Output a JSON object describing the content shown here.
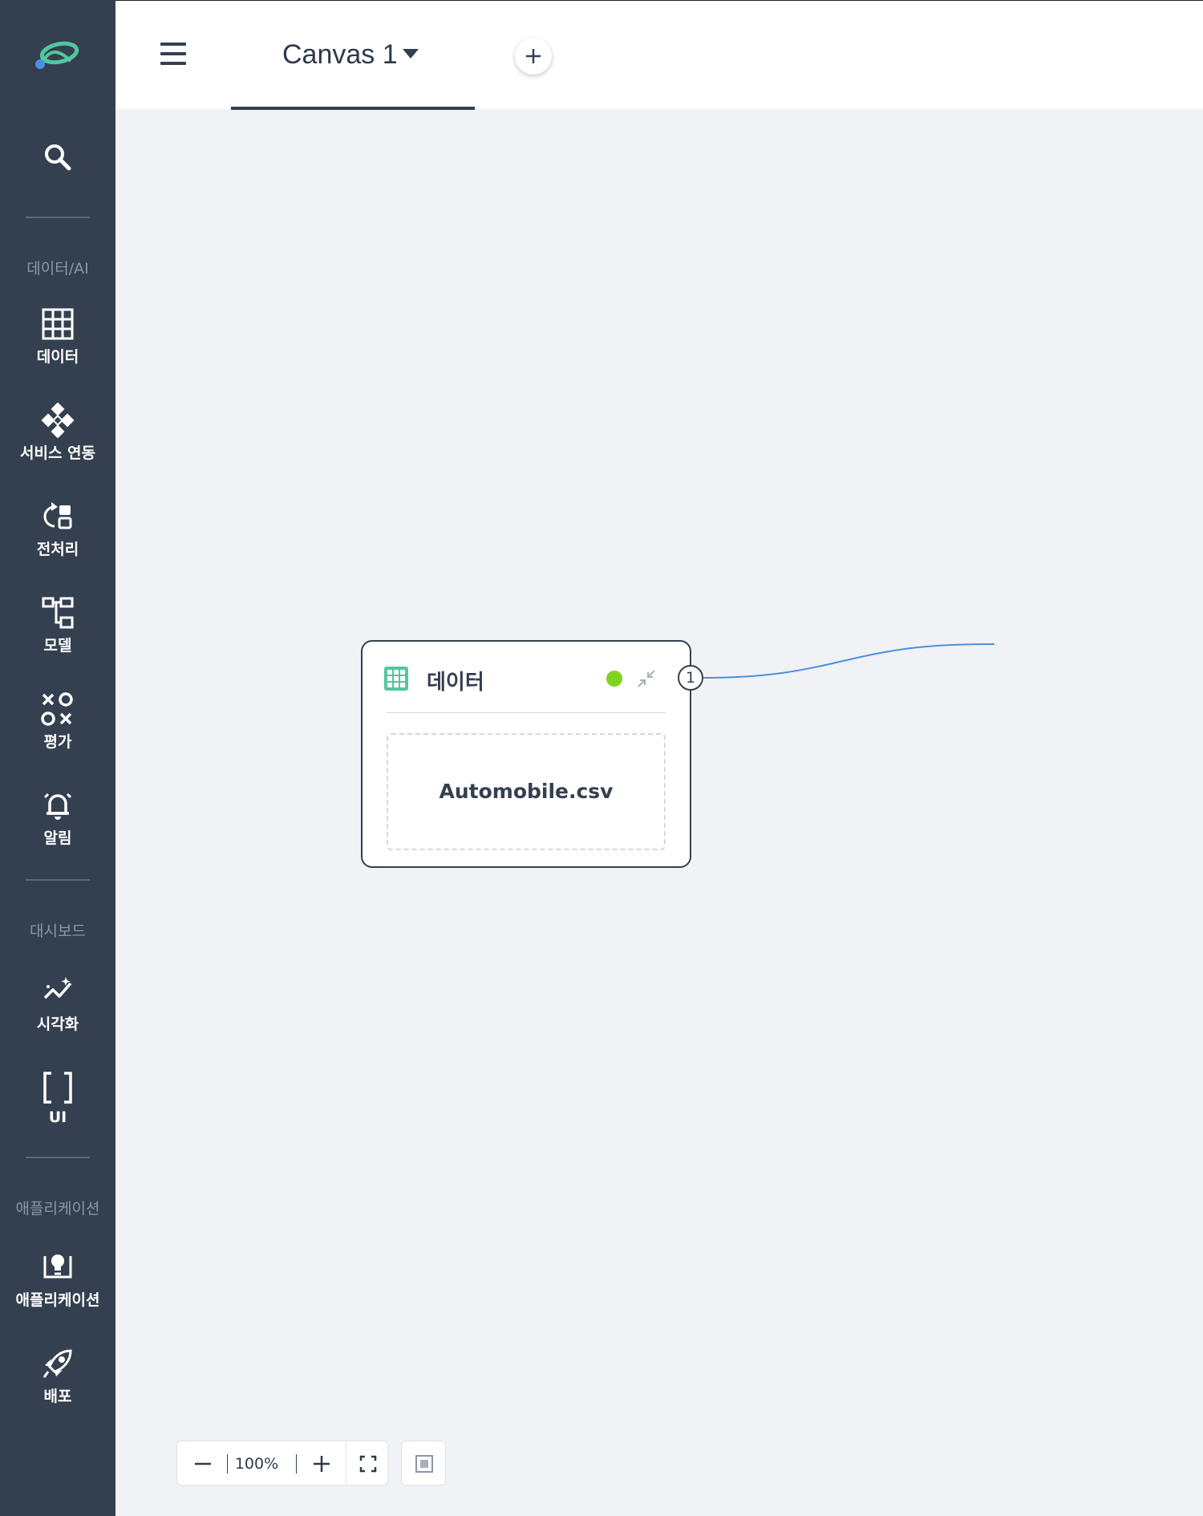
{
  "sidebar": {
    "logo_icon": "app-logo-icon",
    "search_icon": "search-icon",
    "sections": [
      {
        "label": "데이터/AI"
      },
      {
        "label": "대시보드"
      },
      {
        "label": "애플리케이션"
      }
    ],
    "items": [
      {
        "label": "데이터",
        "icon": "table-grid-icon"
      },
      {
        "label": "서비스 연동",
        "icon": "diamond-cluster-icon"
      },
      {
        "label": "전처리",
        "icon": "refresh-blocks-icon"
      },
      {
        "label": "모델",
        "icon": "model-tree-icon"
      },
      {
        "label": "평가",
        "icon": "tic-tac-toe-icon"
      },
      {
        "label": "알림",
        "icon": "bell-icon"
      },
      {
        "label": "시각화",
        "icon": "sparkle-chart-icon"
      },
      {
        "label": "UI",
        "icon": "brackets-icon"
      },
      {
        "label": "애플리케이션",
        "icon": "app-lightbulb-icon"
      },
      {
        "label": "배포",
        "icon": "rocket-icon"
      }
    ]
  },
  "topbar": {
    "menu_icon": "hamburger-icon",
    "tab_label": "Canvas 1",
    "tab_caret_icon": "caret-down-icon",
    "add_tab_icon": "plus-icon"
  },
  "canvas": {
    "node": {
      "icon": "table-grid-icon",
      "title": "데이터",
      "status_color": "#7ed321",
      "collapse_icon": "collapse-arrows-icon",
      "file_name": "Automobile.csv",
      "port_label": "1"
    },
    "edge_color": "#4a90e2"
  },
  "zoom": {
    "minus_icon": "minus-icon",
    "value": "100%",
    "plus_icon": "plus-icon",
    "fit_icon": "fit-screen-icon",
    "minimap_icon": "minimap-icon"
  },
  "colors": {
    "sidebar_bg": "#34404f",
    "canvas_bg": "#f0f2f5",
    "accent_green": "#52c7a0"
  }
}
